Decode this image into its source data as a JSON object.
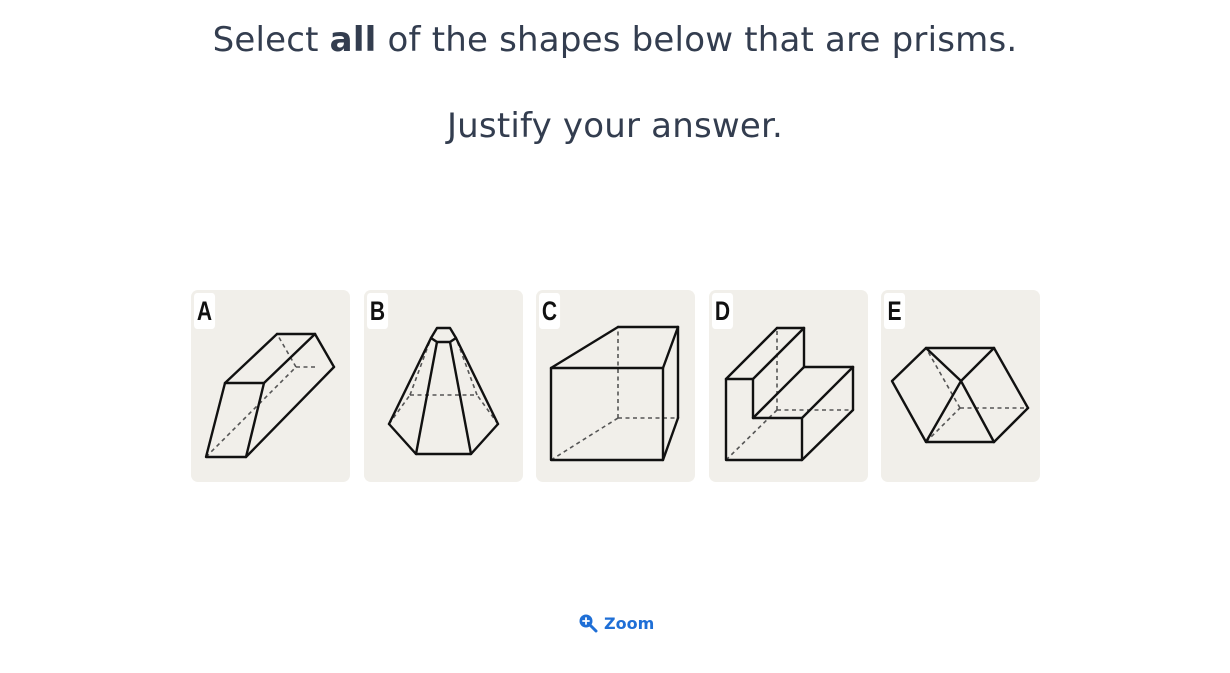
{
  "question": {
    "line1_before": "Select ",
    "line1_emphasis": "all",
    "line1_after": " of the shapes below that are prisms.",
    "line2": "Justify your answer."
  },
  "shapes": [
    {
      "label": "A",
      "icon": "trapezoidal-prism-icon"
    },
    {
      "label": "B",
      "icon": "hexagonal-frustum-icon"
    },
    {
      "label": "C",
      "icon": "cuboid-icon"
    },
    {
      "label": "D",
      "icon": "l-shaped-prism-icon"
    },
    {
      "label": "E",
      "icon": "rhombic-prism-icon"
    }
  ],
  "zoom": {
    "label": "Zoom",
    "icon": "zoom-in-icon",
    "color": "#1f6fd6"
  },
  "colors": {
    "text": "#333d4f",
    "card_background": "#f1efea"
  }
}
